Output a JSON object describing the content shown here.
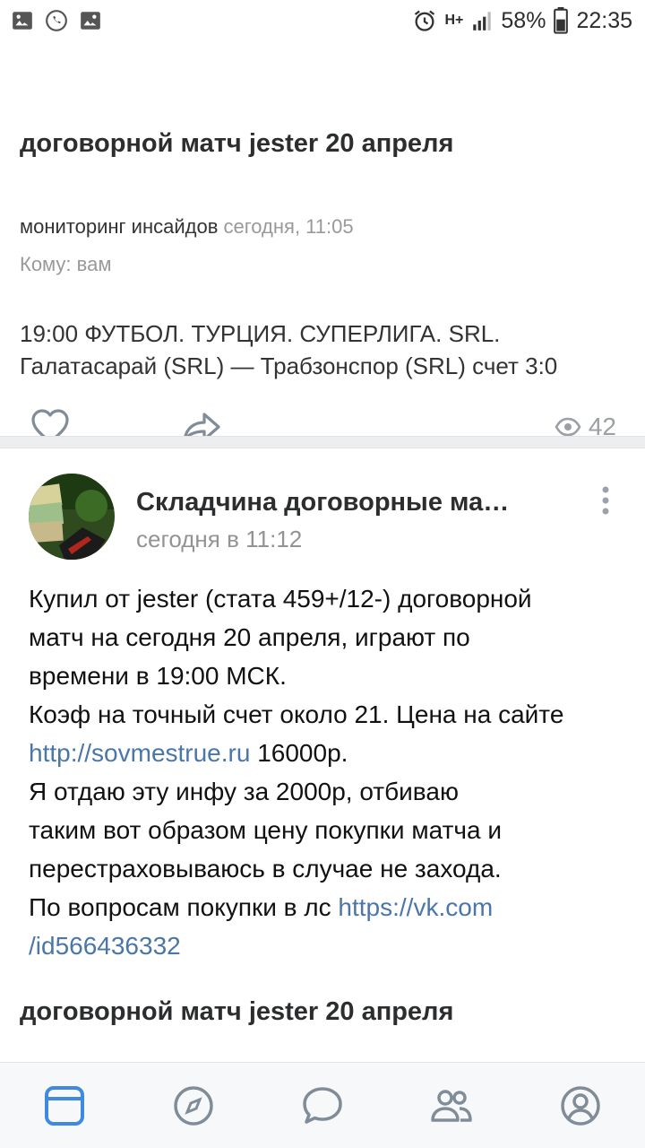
{
  "status_bar": {
    "battery": "58%",
    "time": "22:35",
    "network": "H+"
  },
  "repost": {
    "title": "договорной матч jester 20 апреля",
    "author": "мониторинг инсайдов",
    "time": "сегодня, 11:05",
    "to": "Кому: вам",
    "body_line1": "19:00 ФУТБОЛ. ТУРЦИЯ. СУПЕРЛИГА. SRL.",
    "body_line2": "Галатасарай (SRL) — Трабзонспор (SRL) счет 3:0",
    "views": "42"
  },
  "post": {
    "group_name": "Складчина договорные ма…",
    "time": "сегодня в 11:12",
    "line1": "Купил от jester (стата 459+/12-) договорной",
    "line2": "матч на сегодня 20 апреля, играют по",
    "line3": "времени в 19:00 МСК.",
    "line4": "Коэф на точный счет около 21. Цена на сайте",
    "link1": "http://sovmestrue.ru",
    "line5_tail": " 16000р.",
    "line6": "Я отдаю эту инфу за 2000р, отбиваю",
    "line7": "таким вот образом цену покупки матча и",
    "line8": "перестраховываюсь в случае не захода.",
    "line9_head": "По вопросам покупки в лс ",
    "link2a": "https://vk.com",
    "link2b": "/id566436332",
    "footer_title": "договорной матч jester 20 апреля"
  },
  "colors": {
    "accent": "#4a76a8",
    "muted": "#999999",
    "icon": "#818c99",
    "nav_active": "#3f8ae0"
  },
  "nav": [
    "news-icon",
    "explore-icon",
    "messages-icon",
    "friends-icon",
    "profile-icon"
  ]
}
